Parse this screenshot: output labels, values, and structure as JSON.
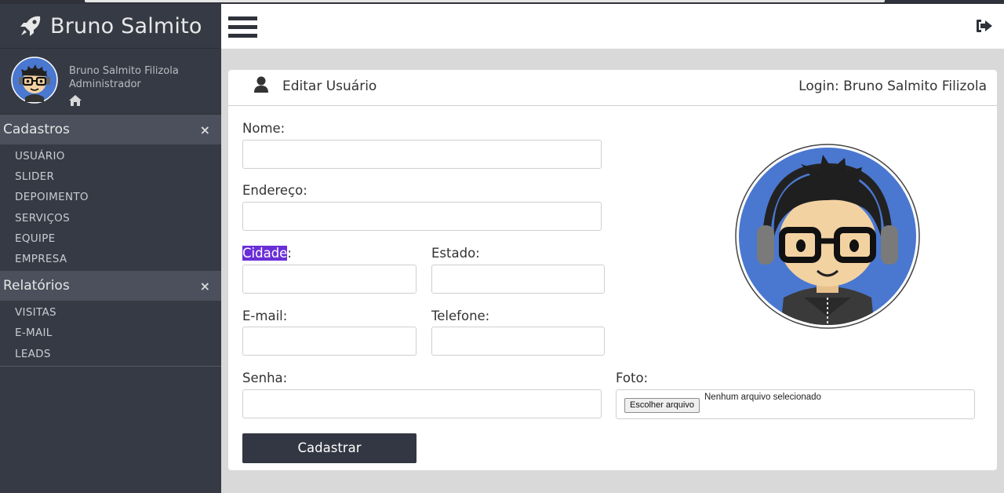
{
  "sidebar": {
    "brand": "Bruno Salmito",
    "profile": {
      "name": "Bruno Salmito Filizola",
      "role": "Administrador"
    },
    "sections": [
      {
        "title": "Cadastros",
        "close": "×",
        "items": [
          "USUÁRIO",
          "SLIDER",
          "DEPOIMENTO",
          "SERVIÇOS",
          "EQUIPE",
          "EMPRESA"
        ]
      },
      {
        "title": "Relatórios",
        "close": "×",
        "items": [
          "VISITAS",
          "E-MAIL",
          "LEADS"
        ]
      }
    ]
  },
  "header": {
    "menu_icon": "hamburger-icon",
    "logout_icon": "sign-out-icon"
  },
  "card": {
    "title": "Editar Usuário",
    "login": "Login: Bruno Salmito Filizola"
  },
  "form": {
    "nome_label": "Nome:",
    "nome_value": "",
    "endereco_label": "Endereço:",
    "endereco_value": "",
    "cidade_label": "Cidade",
    "cidade_colon": ":",
    "cidade_value": "",
    "estado_label": "Estado:",
    "estado_value": "",
    "email_label": "E-mail:",
    "email_value": "",
    "telefone_label": "Telefone:",
    "telefone_value": "",
    "senha_label": "Senha:",
    "senha_value": "",
    "foto_label": "Foto:",
    "file_button": "Escolher arquivo",
    "file_status": "Nenhum arquivo selecionado",
    "submit": "Cadastrar"
  },
  "colors": {
    "sidebar": "#363a44",
    "section_head": "#4b505c",
    "accent_button": "#333743",
    "selection": "#6a2ed8",
    "avatar_bg": "#4a78d0"
  }
}
